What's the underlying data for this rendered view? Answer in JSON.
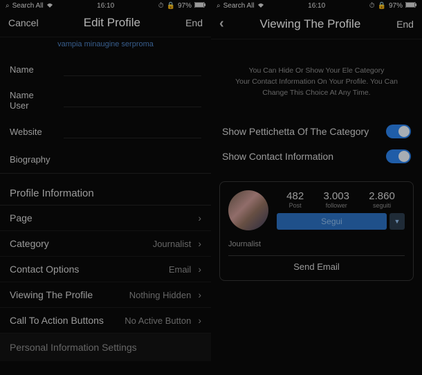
{
  "statusbar": {
    "search": "Search All",
    "time": "16:10",
    "battery": "97%"
  },
  "left": {
    "nav": {
      "cancel": "Cancel",
      "title": "Edit Profile",
      "end": "End"
    },
    "photo_link": "vampia minaugine serproma",
    "fields": {
      "name_label": "Name",
      "nameuser_l1": "Name",
      "nameuser_l2": "User",
      "website_label": "Website",
      "biography_label": "Biography"
    },
    "section_title": "Profile Information",
    "rows": {
      "page": {
        "label": "Page",
        "value": ""
      },
      "category": {
        "label": "Category",
        "value": "Journalist"
      },
      "contact": {
        "label": "Contact Options",
        "value": "Email"
      },
      "viewing": {
        "label": "Viewing The Profile",
        "value": "Nothing Hidden"
      },
      "cta": {
        "label": "Call To Action Buttons",
        "value": "No Active Button"
      }
    },
    "personal": "Personal Information Settings"
  },
  "right": {
    "nav": {
      "title": "Viewing The Profile",
      "end": "End"
    },
    "help": {
      "line1": "You Can Hide Or Show Your Ele Category",
      "line2": "Your Contact Information On Your Profile. You Can",
      "line3": "Change This Choice At Any Time."
    },
    "toggles": {
      "category": "Show Pettichetta Of The Category",
      "contact": "Show Contact Information"
    },
    "preview": {
      "stats": {
        "posts_n": "482",
        "posts_l": "Post",
        "followers_n": "3.003",
        "followers_l": "follower",
        "following_n": "2.860",
        "following_l": "seguiti"
      },
      "follow_btn": "Segui",
      "job": "Journalist",
      "send_email": "Send Email"
    }
  }
}
